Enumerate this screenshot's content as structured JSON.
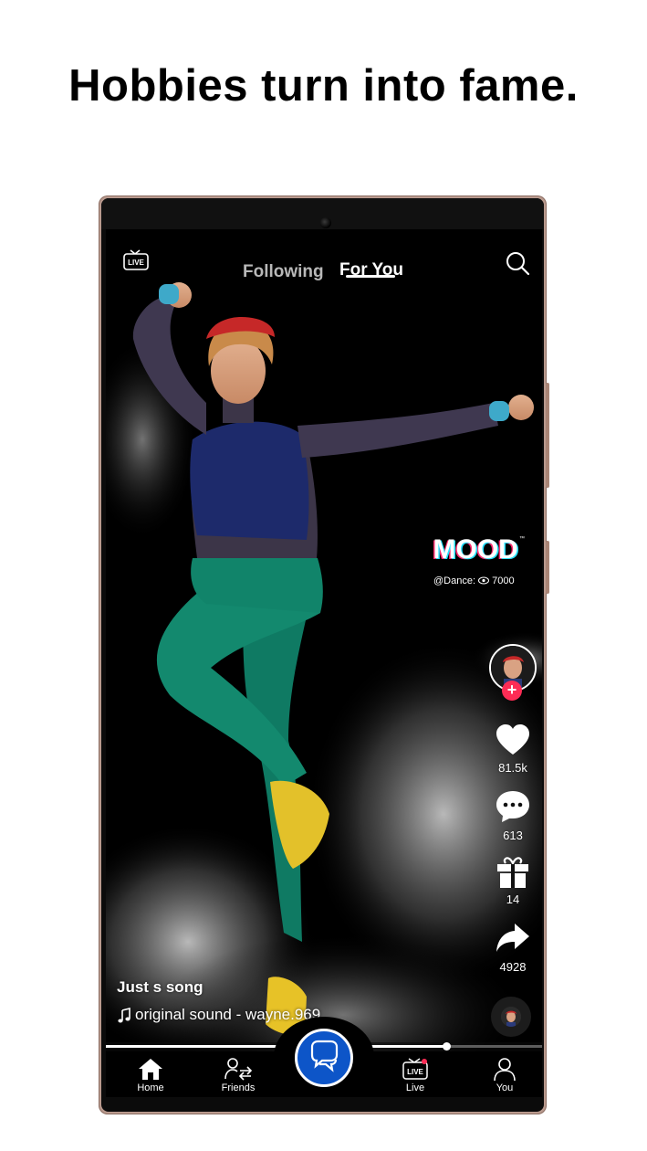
{
  "headline": "Hobbies turn into fame.",
  "top_bar": {
    "live_label": "LIVE",
    "tabs": [
      {
        "label": "Following",
        "active": false
      },
      {
        "label": "For You",
        "active": true
      }
    ]
  },
  "badge": {
    "logo_text": "MOOD",
    "handle": "@Dance:",
    "views": "7000"
  },
  "rail": {
    "likes": "81.5k",
    "comments": "613",
    "gifts": "14",
    "shares": "4928"
  },
  "caption": {
    "title": "Just s song",
    "sound": "original sound - wayne.969"
  },
  "playback": {
    "progress": 0.78
  },
  "bottom_nav": {
    "items": [
      {
        "label": "Home",
        "icon": "home-icon",
        "active": true
      },
      {
        "label": "Friends",
        "icon": "friends-icon",
        "active": false
      },
      {
        "label": "",
        "icon": "chat-icon",
        "active": false
      },
      {
        "label": "Live",
        "icon": "live-tv-icon",
        "active": false
      },
      {
        "label": "You",
        "icon": "profile-icon",
        "active": false
      }
    ],
    "live_badge": "LIVE"
  },
  "colors": {
    "accent_red": "#fe2c55",
    "fab_blue": "#0d55c8",
    "background": "#000000"
  }
}
